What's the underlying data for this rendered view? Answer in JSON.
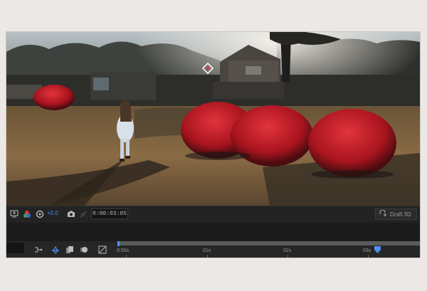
{
  "viewer": {
    "exposure_value": "+0.0",
    "timecode": "0:00:03:05",
    "renderer_label": "Draft 3D"
  },
  "timeline": {
    "ruler_labels": [
      "0:00s",
      "01s",
      "02s",
      "03s"
    ],
    "playhead_fraction": 0.97
  },
  "colors": {
    "accent": "#4f8ff0",
    "panel": "#1d1d1d",
    "red_bush": "#c8202a"
  },
  "icons": {
    "toolbar": [
      "region-of-interest-icon",
      "color-channels-icon",
      "exposure-reset-icon",
      "snapshot-icon",
      "show-snapshot-icon",
      "renderer-icon"
    ],
    "timeline": [
      "composition-mini-flowchart-icon",
      "draft-3d-icon",
      "frame-blending-icon",
      "motion-blur-icon",
      "graph-editor-icon"
    ],
    "viewer": [
      "anchor-point-icon"
    ]
  }
}
